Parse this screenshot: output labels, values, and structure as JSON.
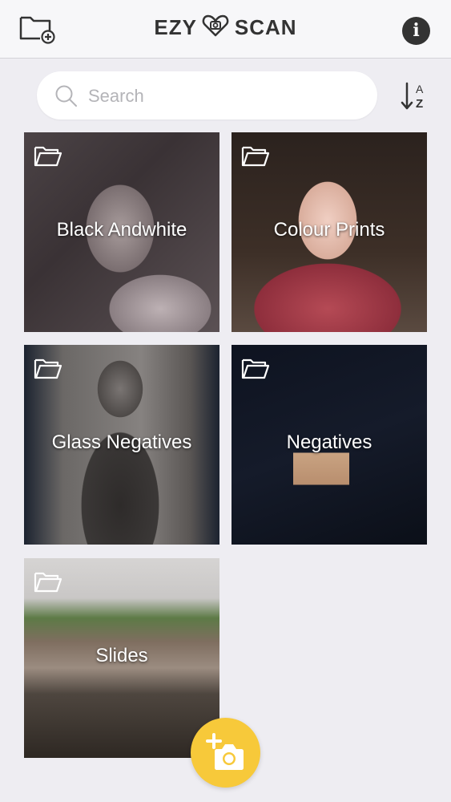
{
  "header": {
    "logo_left": "EZY",
    "logo_right": "SCAN",
    "new_folder_icon": "folder-plus-icon",
    "info_icon": "info-icon",
    "info_glyph": "i"
  },
  "search": {
    "placeholder": "Search",
    "value": ""
  },
  "sort": {
    "icon": "sort-az-icon"
  },
  "folders": [
    {
      "label": "Black Andwhite"
    },
    {
      "label": "Colour Prints"
    },
    {
      "label": "Glass Negatives"
    },
    {
      "label": "Negatives"
    },
    {
      "label": "Slides"
    }
  ],
  "fab": {
    "icon": "add-photo-camera-icon"
  },
  "colors": {
    "accent": "#f7c93a",
    "background": "#eeedf2",
    "header": "#f7f7f9"
  }
}
